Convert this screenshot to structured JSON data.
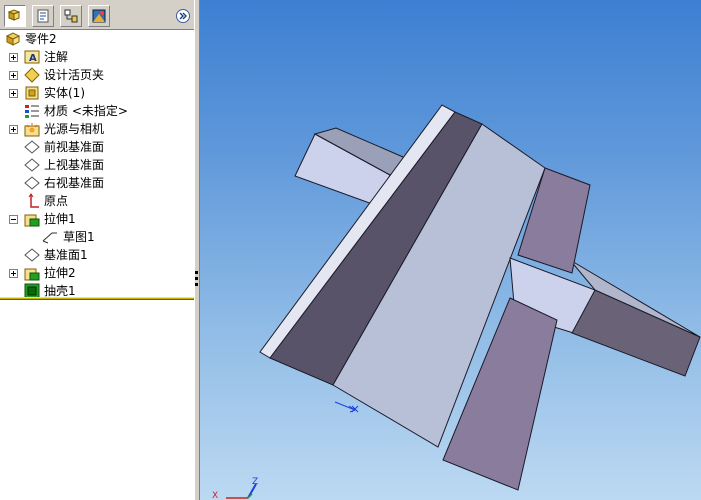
{
  "toolbar": {
    "tabs": [
      {
        "name": "featuremanager-tab",
        "icon": "feature-tree-icon",
        "active": true
      },
      {
        "name": "propertymanager-tab",
        "icon": "property-icon",
        "active": false
      },
      {
        "name": "configurationmanager-tab",
        "icon": "configuration-icon",
        "active": false
      },
      {
        "name": "displaymanager-tab",
        "icon": "appearance-icon",
        "active": false
      }
    ],
    "expand_icon": "double-chevron-right-icon"
  },
  "tree": {
    "root": {
      "label": "零件2",
      "icon": "part-icon"
    },
    "items": [
      {
        "label": "注解",
        "icon": "annotation-icon",
        "expander": "plus"
      },
      {
        "label": "设计活页夹",
        "icon": "design-binder-icon",
        "expander": "plus"
      },
      {
        "label": "实体(1)",
        "icon": "solid-body-icon",
        "expander": "plus"
      },
      {
        "label": "材质 <未指定>",
        "icon": "material-icon",
        "expander": "none"
      },
      {
        "label": "光源与相机",
        "icon": "lights-cameras-icon",
        "expander": "plus"
      },
      {
        "label": "前视基准面",
        "icon": "plane-icon",
        "expander": "none"
      },
      {
        "label": "上视基准面",
        "icon": "plane-icon",
        "expander": "none"
      },
      {
        "label": "右视基准面",
        "icon": "plane-icon",
        "expander": "none"
      },
      {
        "label": "原点",
        "icon": "origin-icon",
        "expander": "none"
      },
      {
        "label": "拉伸1",
        "icon": "extrude-icon",
        "expander": "minus"
      },
      {
        "label": "草图1",
        "icon": "sketch-icon",
        "expander": "none"
      },
      {
        "label": "基准面1",
        "icon": "plane-icon",
        "expander": "none"
      },
      {
        "label": "拉伸2",
        "icon": "extrude-icon",
        "expander": "plus"
      },
      {
        "label": "抽壳1",
        "icon": "shell-icon",
        "expander": "none"
      }
    ]
  },
  "viewport": {
    "triad": {
      "x_label": "X",
      "y_label": "Y",
      "z_label": "Z"
    },
    "colors": {
      "bg_top": "#3d7fd2",
      "bg_bottom": "#bcd9f2",
      "face_light": "#b8c0d8",
      "face_dark": "#5a5468",
      "face_purple": "#8a7c9c",
      "rollback_bar": "#c8b400"
    }
  }
}
